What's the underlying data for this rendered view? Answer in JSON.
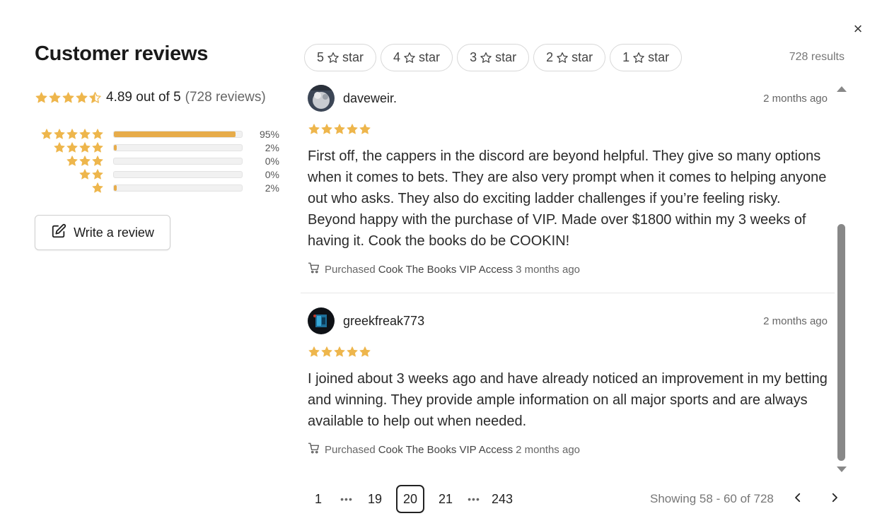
{
  "colors": {
    "star": "#eeb64c",
    "bar_fill": "#e7ac4a",
    "scrollbar": "#888888"
  },
  "header": {
    "title": "Customer reviews",
    "close_icon": "close-icon",
    "close_glyph": "×"
  },
  "summary": {
    "rating_value": 4.89,
    "rating_text": "4.89 out of 5",
    "count_text": "(728 reviews)",
    "distribution": [
      {
        "stars": 5,
        "fraction": 0.95,
        "label": "95%"
      },
      {
        "stars": 4,
        "fraction": 0.02,
        "label": "2%"
      },
      {
        "stars": 3,
        "fraction": 0.0,
        "label": "0%"
      },
      {
        "stars": 2,
        "fraction": 0.0,
        "label": "0%"
      },
      {
        "stars": 1,
        "fraction": 0.02,
        "label": "2%"
      }
    ],
    "write_button": {
      "label": "Write a review",
      "icon": "edit-icon"
    }
  },
  "filters": {
    "items": [
      {
        "num": "5",
        "label": "star"
      },
      {
        "num": "4",
        "label": "star"
      },
      {
        "num": "3",
        "label": "star"
      },
      {
        "num": "2",
        "label": "star"
      },
      {
        "num": "1",
        "label": "star"
      }
    ],
    "results_text": "728 results"
  },
  "reviews": [
    {
      "user": "daveweir.",
      "date": "2 months ago",
      "rating": 5,
      "body": "First off, the cappers in the discord are beyond helpful. They give so many options when it comes to bets. They are also very prompt when it comes to helping anyone out who asks. They also do exciting ladder challenges if you’re feeling risky. Beyond happy with the purchase of VIP. Made over $1800 within my 3 weeks of having it. Cook the books do be COOKIN!",
      "purchase_prefix": "Purchased",
      "product": "Cook The Books VIP Access",
      "purchase_when": "3 months ago"
    },
    {
      "user": "greekfreak773",
      "date": "2 months ago",
      "rating": 5,
      "body": "I joined about 3 weeks ago and have already noticed an improvement in my betting and winning. They provide ample information on all major sports and are always available to help out when needed.",
      "purchase_prefix": "Purchased",
      "product": "Cook The Books VIP Access",
      "purchase_when": "2 months ago"
    }
  ],
  "pagination": {
    "first": "1",
    "ellipsis": "•••",
    "prev_page": "19",
    "current": "20",
    "next_page": "21",
    "last": "243",
    "showing": "Showing 58 - 60 of 728",
    "prev_icon": "chevron-left-icon",
    "next_icon": "chevron-right-icon"
  }
}
